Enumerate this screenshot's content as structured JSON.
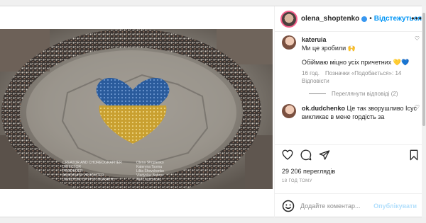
{
  "post": {
    "username": "olena_shoptenko",
    "follow_label": "Відстежуться",
    "separator": "•"
  },
  "comments": [
    {
      "author": "kateruia",
      "text_line1": "Ми це зробили 🙌",
      "text_line2": "Обіймаю міцно усіх причетних 💛💙",
      "age": "16 год.",
      "likes": "Позначки «Подобається»: 14",
      "reply": "Відповісти",
      "view_replies": "Переглянути відповіді (2)"
    },
    {
      "author": "ok.dudchenko",
      "text": "Це так зворушливо Ісус викликає в мене гордість за"
    }
  ],
  "stats": {
    "views": "29 206 переглядів",
    "time_ago": "18 ГОД ТОМУ"
  },
  "composer": {
    "placeholder": "Додайте коментар...",
    "publish_label": "Опублікувати"
  },
  "media_credits": {
    "left": [
      "CREATOR AND CHOREOGRAPHER",
      "DIRECTOR",
      "PRODUCER",
      "ASSOCIATE PRODUCER",
      "DIRECTOR OF PHOTOGRAPHY"
    ],
    "right": [
      "Olena Shoptenko",
      "Kateryna Tsoma",
      "Liliia Shovchenko",
      "Vladyslav Bobrov",
      "Neli Dudchenko"
    ]
  },
  "icons": {
    "more": "more-horizontal-icon",
    "heart": "heart-icon",
    "comment": "comment-icon",
    "share": "share-icon",
    "save": "bookmark-icon",
    "emoji": "emoji-icon"
  },
  "colors": {
    "accent": "#0095f6",
    "text": "#262626",
    "muted": "#8e8e8e",
    "ukraine_blue": "#2d5fa0",
    "ukraine_yellow": "#d7b33a"
  }
}
